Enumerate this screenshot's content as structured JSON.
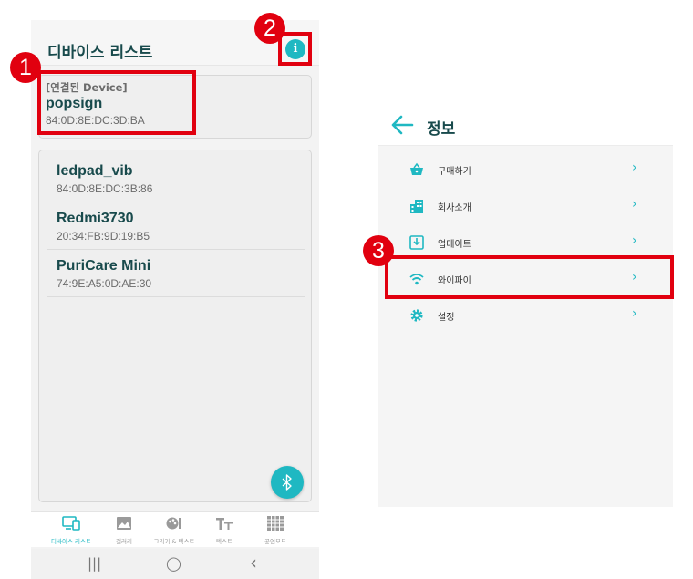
{
  "left_screen": {
    "title": "디바이스 리스트",
    "info_icon": "info-icon",
    "connected": {
      "label": "[연결된 Device]",
      "name": "popsign",
      "mac": "84:0D:8E:DC:3D:BA"
    },
    "devices": [
      {
        "name": "ledpad_vib",
        "mac": "84:0D:8E:DC:3B:86"
      },
      {
        "name": "Redmi3730",
        "mac": "20:34:FB:9D:19:B5"
      },
      {
        "name": "PuriCare Mini",
        "mac": "74:9E:A5:0D:AE:30"
      }
    ],
    "bluetooth_icon": "bluetooth-icon",
    "nav": [
      {
        "label": "디바이스 리스트",
        "icon": "devices-icon",
        "active": true
      },
      {
        "label": "갤러리",
        "icon": "gallery-icon",
        "active": false
      },
      {
        "label": "그리기 & 텍스트",
        "icon": "draw-text-icon",
        "active": false
      },
      {
        "label": "텍스트",
        "icon": "text-icon",
        "active": false
      },
      {
        "label": "공연모드",
        "icon": "grid-icon",
        "active": false
      }
    ],
    "system_nav": {
      "recents": "|||",
      "home": "◯",
      "back": "‹"
    }
  },
  "right_screen": {
    "title": "정보",
    "menu": [
      {
        "label": "구매하기",
        "icon": "basket-icon"
      },
      {
        "label": "회사소개",
        "icon": "building-icon"
      },
      {
        "label": "업데이트",
        "icon": "download-icon"
      },
      {
        "label": "와이파이",
        "icon": "wifi-icon"
      },
      {
        "label": "설정",
        "icon": "gear-icon"
      }
    ],
    "chevron": "›"
  },
  "annotations": {
    "badge_1": "1",
    "badge_2": "2",
    "badge_3": "3",
    "color": "#e1000f"
  },
  "colors": {
    "accent": "#1fb8c2",
    "title_text": "#184a4c"
  }
}
